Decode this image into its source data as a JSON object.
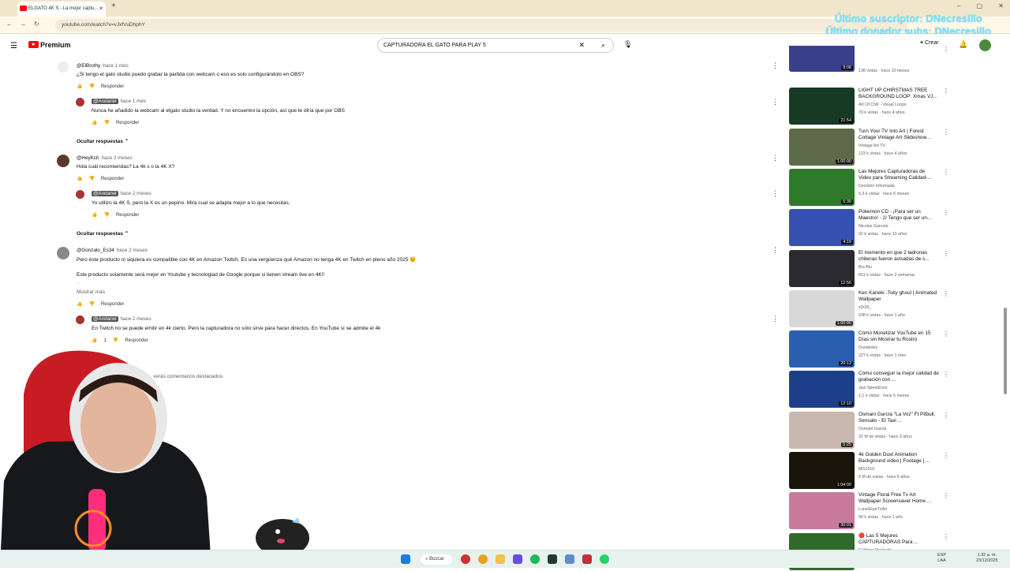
{
  "browser": {
    "tab_title": "ELGATO 4K S - La mejor captu...",
    "url": "youtube.com/watch?v=vJxfVuDhphY",
    "overlay_line1": "Último suscriptor: DNecresillo",
    "overlay_line2": "Último donador subs: DNecresillo"
  },
  "youtube": {
    "logo_label": "Premium",
    "search_query": "CAPTURADORA EL GATO PARA PLAY 5",
    "create_label": "Crear"
  },
  "comments": [
    {
      "author": "@ElBrothy",
      "time": "hace 1 mes",
      "text": "¿Si tengo el gato studio puedo grabar la partida con webcam o eso es solo configurándolo en OBS?",
      "reply_label": "Responder"
    },
    {
      "author": "@Andariel",
      "time": "hace 1 mes",
      "text": "Nunca he añadido la webcam al elgato studio la verdad. Y no encuentro la opción, así que te diría que por OBS",
      "reply_label": "Responder"
    },
    {
      "author": "@HeyKch",
      "time": "hace 2 meses",
      "text": "Hola cuál recomiendas? La 4k s o la 4K X?",
      "reply_label": "Responder"
    },
    {
      "author": "@Andariel",
      "time": "hace 2 meses",
      "text": "Yo utilizo la 4K S, pero la X es un pepino. Mira cual se adapta mejor a lo que necesitas.",
      "reply_label": "Responder"
    },
    {
      "author": "@Gonzalo_Es34",
      "time": "hace 2 meses",
      "text": "Pero éste producto ni siquiera es compatible con 4K en Amazon Twitch. Es una vergüenza qué Amazon no tenga 4K en Twitch en pleno año 2025 😢",
      "text2": "Este producto solamente será mejor en Youtube y tecnologiad de Google porque si tienen stream live en 4K!!",
      "text3": "..",
      "more_label": "Mostrar más",
      "reply_label": "Responder"
    },
    {
      "author": "@Andariel",
      "time": "hace 2 meses",
      "text": "En Twitch no se puede emitir en 4k cierto. Pero la capturadora no sólo sirve para hacer directos. En YouTube sí se admite el 4k",
      "likes": "1",
      "reply_label": "Responder"
    }
  ],
  "hide_replies_label": "Ocultar respuestas",
  "highlighted_comments_label": "verás comentarios destacados",
  "recommendations": [
    {
      "title": "",
      "channel": "",
      "meta": "138 vistas · hace 10 meses",
      "duration": "8:08",
      "color": "#3a3f8a"
    },
    {
      "title": "LIGHT UP CHIRSTMAS TREE BACKGROUND LOOP: Xmas VJ...",
      "channel": "Art Of Chill - Visual Loops",
      "meta": "79 k vistas · hace 4 años",
      "duration": "21:54",
      "color": "#163a24"
    },
    {
      "title": "Turn Your TV Into Art | Forest Cottage Vintage Art Slideshow...",
      "channel": "Vintage Art TV",
      "meta": "123 k vistas · hace 4 años",
      "duration": "1:00:00",
      "color": "#5c6a4a"
    },
    {
      "title": "Las Mejores Capturadoras de Video para Streaming Calidad-...",
      "channel": "Decisión Informada",
      "meta": "5,2 k vistas · hace 6 meses",
      "duration": "6:30",
      "color": "#2f7a2a"
    },
    {
      "title": "Pokemon CD - ¡Para ser un Maestro! - 2/ Tengo que ser un...",
      "channel": "Nicolas Garcete",
      "meta": "92 k vistas · hace 13 años",
      "duration": "4:19",
      "color": "#3550b0"
    },
    {
      "title": "El momento en que 2 ladronas chilenas fueron avisadas de s...",
      "channel": "Bio Bio",
      "meta": "651 k vistas · hace 2 semanas",
      "duration": "12:56",
      "color": "#2a2a30"
    },
    {
      "title": "Ken Kaneki -Toky ghoul | Animated Wallpaper",
      "channel": "z3r28_",
      "meta": "238 k vistas · hace 1 año",
      "duration": "1:00:00",
      "color": "#d8d8d8"
    },
    {
      "title": "Cómo Monetizar YouTube en 15 Días sin Mostrar tu Rostro",
      "channel": "Duodedos",
      "meta": "227 k vistas · hace 1 mes",
      "duration": "20:12",
      "color": "#2a5fb0"
    },
    {
      "title": "Cómo conseguir la mejor calidad de grabación con ...",
      "channel": "Javi Speedruns",
      "meta": "1,1 k vistas · hace 5 meses",
      "duration": "12:10",
      "color": "#1e3f8a"
    },
    {
      "title": "Osmani García \"La Voz\" Ft Pitbull, Sensato - El Taxi ...",
      "channel": "Osmani Garcia",
      "meta": "32 M de vistas · hace 3 años",
      "duration": "5:25",
      "color": "#c8b8b0"
    },
    {
      "title": "4k Golden Dust Animation Background video | Footage | ...",
      "channel": "MG1010",
      "meta": "5 M de vistas · hace 6 años",
      "duration": "1:04:00",
      "color": "#1a140a"
    },
    {
      "title": "Vintage Floral Free Tv Art Wallpaper Screensaver Home ...",
      "channel": "LunaSkyeTvArt",
      "meta": "90 k vistas · hace 1 año",
      "duration": "30:01",
      "color": "#c87a9a"
    },
    {
      "title": "🔴 Las 5 Mejores CAPTURADORAS Para ...",
      "channel": "El Mejor Producto",
      "meta": "",
      "duration": "",
      "color": "#2f6a2a"
    }
  ],
  "taskbar": {
    "search_label": "Buscar",
    "lang": "ESP",
    "lang2": "LAA",
    "time": "1:32 a. m.",
    "date": "23/12/2025"
  }
}
